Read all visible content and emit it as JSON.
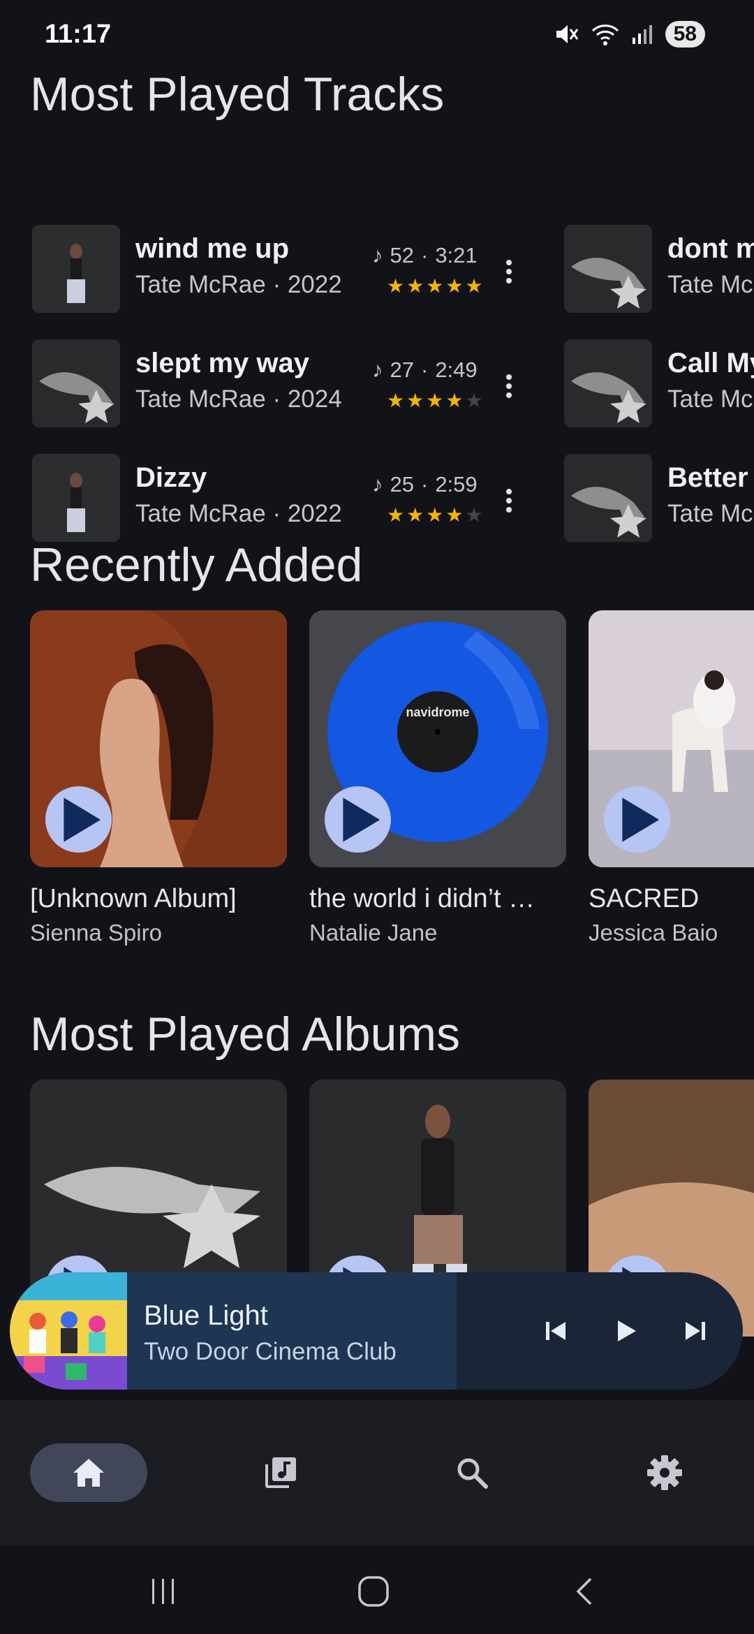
{
  "status": {
    "time": "11:17",
    "battery": "58"
  },
  "sections": {
    "most_played_tracks": "Most Played Tracks",
    "recently_added": "Recently Added",
    "most_played_albums": "Most Played Albums"
  },
  "tracks": [
    {
      "title": "wind me up",
      "artist_year": "Tate McRae · 2022",
      "plays": "52",
      "duration": "3:21",
      "rating": 5
    },
    {
      "title": "slept my way",
      "artist_year": "Tate McRae · 2024",
      "plays": "27",
      "duration": "2:49",
      "rating": 4
    },
    {
      "title": "Dizzy",
      "artist_year": "Tate McRae · 2022",
      "plays": "25",
      "duration": "2:59",
      "rating": 4
    }
  ],
  "tracks_col2": [
    {
      "title": "dont m",
      "artist": "Tate Mc"
    },
    {
      "title": "Call My",
      "artist": "Tate Mc"
    },
    {
      "title": "Better T",
      "artist": "Tate Mc"
    }
  ],
  "recently_added": [
    {
      "title": "[Unknown Album]",
      "artist": "Sienna Spiro"
    },
    {
      "title": "the world i didn’t …",
      "artist": "Natalie Jane",
      "cover_text": "navidrome"
    },
    {
      "title": "SACRED",
      "artist": "Jessica Baio"
    }
  ],
  "most_played_albums": [
    {
      "title": "",
      "artist": ""
    },
    {
      "title": "",
      "artist": ""
    },
    {
      "title": "",
      "artist": ""
    }
  ],
  "now_playing": {
    "title": "Blue Light",
    "artist": "Two Door Cinema Club"
  },
  "nav": [
    "home-icon",
    "library-icon",
    "search-icon",
    "settings-icon"
  ],
  "colors": {
    "accent": "#b7c5f5",
    "star": "#f5b400",
    "background": "#121318",
    "mini_player": "#1e3654"
  }
}
